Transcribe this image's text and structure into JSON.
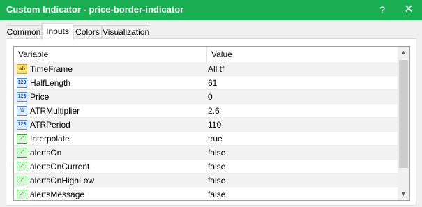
{
  "window": {
    "title": "Custom Indicator - price-border-indicator",
    "help": "?",
    "close": "✕"
  },
  "tabs": [
    {
      "label": "Common",
      "active": false
    },
    {
      "label": "Inputs",
      "active": true
    },
    {
      "label": "Colors",
      "active": false
    },
    {
      "label": "Visualization",
      "active": false
    }
  ],
  "table": {
    "columns": [
      "Variable",
      "Value"
    ],
    "rows": [
      {
        "icon": "ab",
        "icon_name": "string-type-icon",
        "name": "TimeFrame",
        "value": "All tf"
      },
      {
        "icon": "123",
        "icon_name": "integer-type-icon",
        "name": "HalfLength",
        "value": "61"
      },
      {
        "icon": "123",
        "icon_name": "integer-type-icon",
        "name": "Price",
        "value": "0"
      },
      {
        "icon": "½",
        "icon_name": "double-type-icon",
        "name": "ATRMultiplier",
        "value": "2.6"
      },
      {
        "icon": "123",
        "icon_name": "integer-type-icon",
        "name": "ATRPeriod",
        "value": "110"
      },
      {
        "icon": "⟋",
        "icon_name": "bool-type-icon",
        "name": "Interpolate",
        "value": "true"
      },
      {
        "icon": "⟋",
        "icon_name": "bool-type-icon",
        "name": "alertsOn",
        "value": "false"
      },
      {
        "icon": "⟋",
        "icon_name": "bool-type-icon",
        "name": "alertsOnCurrent",
        "value": "false"
      },
      {
        "icon": "⟋",
        "icon_name": "bool-type-icon",
        "name": "alertsOnHighLow",
        "value": "false"
      },
      {
        "icon": "⟋",
        "icon_name": "bool-type-icon",
        "name": "alertsMessage",
        "value": "false"
      }
    ]
  },
  "scrollbar": {
    "up": "▲",
    "down": "▼"
  }
}
